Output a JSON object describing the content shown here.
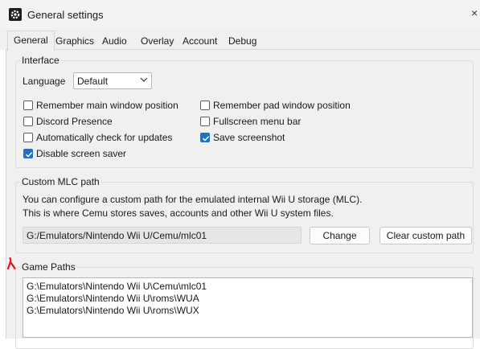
{
  "window": {
    "title": "General settings",
    "close_label": "×",
    "icon": "gear-icon"
  },
  "tabs": [
    {
      "label": "General",
      "active": true
    },
    {
      "label": "Graphics",
      "active": false
    },
    {
      "label": "Audio",
      "active": false
    },
    {
      "label": "Overlay",
      "active": false
    },
    {
      "label": "Account",
      "active": false
    },
    {
      "label": "Debug",
      "active": false
    }
  ],
  "interface": {
    "title": "Interface",
    "language_label": "Language",
    "language_value": "Default",
    "checkboxes": [
      {
        "label": "Remember main window position",
        "checked": false
      },
      {
        "label": "Remember pad window position",
        "checked": false
      },
      {
        "label": "Discord Presence",
        "checked": false
      },
      {
        "label": "Fullscreen menu bar",
        "checked": false
      },
      {
        "label": "Automatically check for updates",
        "checked": false
      },
      {
        "label": "Save screenshot",
        "checked": true
      },
      {
        "label": "Disable screen saver",
        "checked": true
      }
    ]
  },
  "mlc": {
    "title": "Custom MLC path",
    "description_line1": "You can configure a custom path for the emulated internal Wii U storage (MLC).",
    "description_line2": "This is where Cemu stores saves, accounts and other Wii U system files.",
    "path_value": "G:/Emulators/Nintendo Wii U/Cemu/mlc01",
    "change_label": "Change",
    "clear_label": "Clear custom path"
  },
  "game_paths": {
    "title": "Game Paths",
    "items": [
      "G:\\Emulators\\Nintendo Wii U\\Cemu\\mlc01",
      "G:\\Emulators\\Nintendo Wii U\\roms\\WUA",
      "G:\\Emulators\\Nintendo Wii U\\roms\\WUX"
    ]
  },
  "colors": {
    "accent": "#1a73c9",
    "marker": "#e0141e"
  }
}
